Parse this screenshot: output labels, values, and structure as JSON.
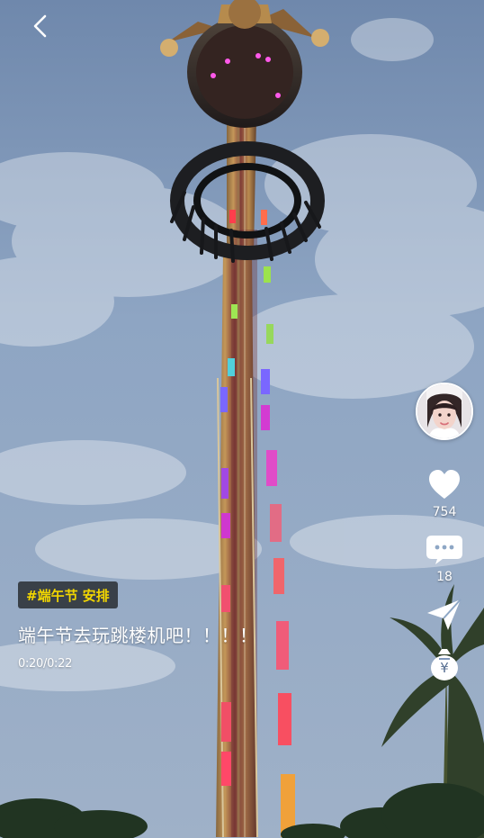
{
  "nav": {
    "back_icon": "chevron-left-icon"
  },
  "sidebar": {
    "avatar_name": "avatar",
    "likes": "754",
    "comments": "18",
    "like_icon": "heart-icon",
    "comment_icon": "comment-bubble-icon",
    "share_icon": "share-arrow-icon",
    "reward_icon": "money-bag-icon"
  },
  "caption": {
    "hashtag": "#端午节",
    "hashtag_extra": "安排",
    "title": "端午节去玩跳楼机吧！！！！",
    "time": "0:20/0:22"
  },
  "colors": {
    "hashtag": "#f2d600",
    "chip_bg": "#1f2124",
    "sky_top": "#6f88ac",
    "sky_bottom": "#9eb4cf"
  }
}
